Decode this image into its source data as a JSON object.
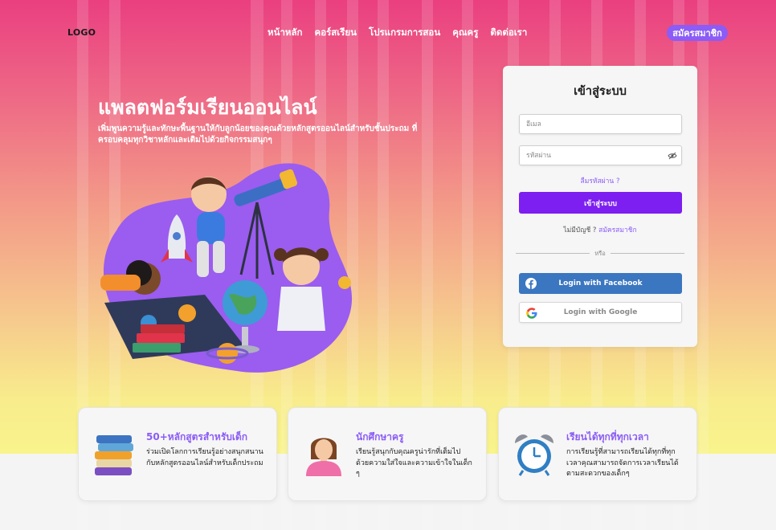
{
  "nav": {
    "logo": "LOGO",
    "links": [
      "หน้าหลัก",
      "คอร์สเรียน",
      "โปรแกรมการสอน",
      "คุณครู",
      "ติดต่อเรา"
    ],
    "signup": "สมัครสมาชิก"
  },
  "hero": {
    "title": "แพลตฟอร์มเรียนออนไลน์",
    "subtitle": "เพิ่มพูนความรู้และทักษะพื้นฐานให้กับลูกน้อยของคุณด้วยหลักสูตรออนไลน์สำหรับชั้นประถม ที่ครอบคลุมทุกวิชาหลักและเติมไปด้วยกิจกรรมสนุกๆ"
  },
  "login": {
    "title": "เข้าสู่ระบบ",
    "email_placeholder": "อีเมล",
    "password_placeholder": "รหัสผ่าน",
    "forgot": "ลืมรหัสผ่าน ?",
    "submit": "เข้าสู่ระบบ",
    "no_account": "ไม่มีบัญชี ?",
    "signup_link": "สมัครสมาชิก",
    "or": "หรือ",
    "facebook": "Login with Facebook",
    "google": "Login with Google"
  },
  "features": [
    {
      "title": "50+หลักสูตรสำหรับเด็ก",
      "desc": "ร่วมเปิดโลกการเรียนรู้อย่างสนุกสนานกับหลักสูตรออนไลน์สำหรับเด็กประถม",
      "icon": "books-icon"
    },
    {
      "title": "นักศึกษาครู",
      "desc": "เรียนรู้สนุกกับคุณครูน่ารักที่เต็มไปด้วยความใส่ใจและความเข้าใจในเด็ก ๆ",
      "icon": "teacher-icon"
    },
    {
      "title": "เรียนได้ทุกที่ทุกเวลา",
      "desc": "การเรียนรู้ที่สามารถเรียนได้ทุกที่ทุกเวลาคุณสามารถจัดการเวลาเรียนได้ตามสะดวกของเด็กๆ",
      "icon": "alarm-clock-icon"
    }
  ],
  "colors": {
    "accent": "#8b5cf6",
    "primary_button": "#7c1ff0",
    "facebook": "#3b76c0"
  }
}
